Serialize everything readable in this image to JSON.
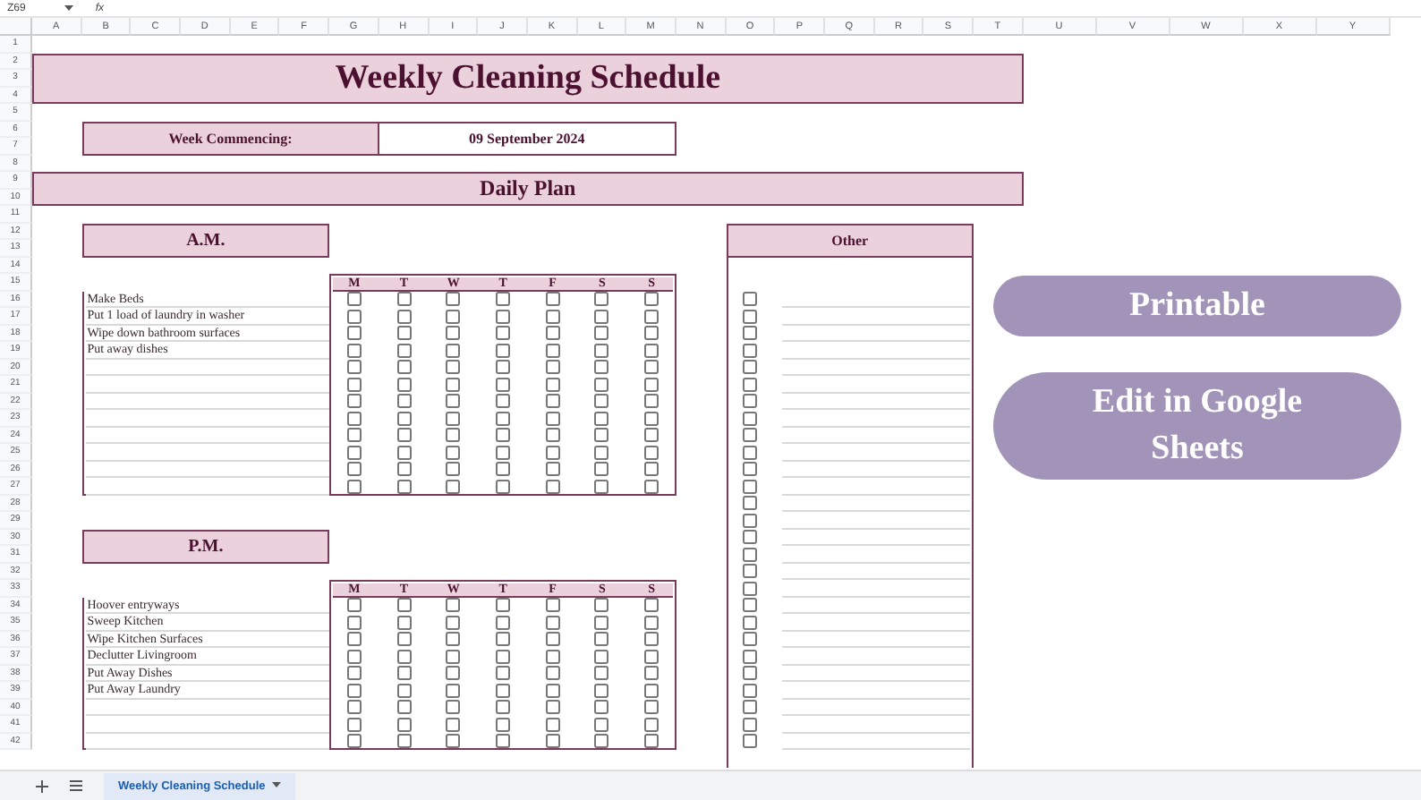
{
  "toolbar": {
    "cell_ref": "Z69",
    "formula_label": "fx"
  },
  "column_headers": [
    "A",
    "B",
    "C",
    "D",
    "E",
    "F",
    "G",
    "H",
    "I",
    "J",
    "K",
    "L",
    "M",
    "N",
    "O",
    "P",
    "Q",
    "R",
    "S",
    "T",
    "U",
    "V",
    "W",
    "X",
    "Y"
  ],
  "row_numbers": [
    "1",
    "2",
    "3",
    "4",
    "5",
    "6",
    "7",
    "8",
    "9",
    "10",
    "11",
    "12",
    "13",
    "14",
    "15",
    "16",
    "17",
    "18",
    "19",
    "20",
    "21",
    "22",
    "23",
    "24",
    "25",
    "26",
    "27",
    "28",
    "29",
    "30",
    "31",
    "32",
    "33",
    "34",
    "35",
    "36",
    "37",
    "38",
    "39",
    "40",
    "41",
    "42"
  ],
  "title": "Weekly Cleaning Schedule",
  "week": {
    "label": "Week Commencing:",
    "value": "09 September 2024"
  },
  "section_title": "Daily Plan",
  "am": {
    "title": "A.M.",
    "days": [
      "M",
      "T",
      "W",
      "T",
      "F",
      "S",
      "S"
    ],
    "tasks": [
      {
        "text": "Make Beds",
        "checks": [
          false,
          false,
          false,
          false,
          false,
          false,
          false
        ]
      },
      {
        "text": "Put 1 load of laundry in washer",
        "checks": [
          false,
          false,
          false,
          false,
          false,
          false,
          false
        ]
      },
      {
        "text": "Wipe down bathroom surfaces",
        "checks": [
          false,
          false,
          false,
          false,
          false,
          false,
          false
        ]
      },
      {
        "text": "Put away dishes",
        "checks": [
          false,
          false,
          false,
          false,
          false,
          false,
          false
        ]
      },
      {
        "checks": [
          false,
          false,
          false,
          false,
          false,
          false,
          false
        ]
      },
      {
        "checks": [
          false,
          false,
          false,
          false,
          false,
          false,
          false
        ]
      },
      {
        "checks": [
          false,
          false,
          false,
          false,
          false,
          false,
          false
        ]
      },
      {
        "checks": [
          false,
          false,
          false,
          false,
          false,
          false,
          false
        ]
      },
      {
        "checks": [
          false,
          false,
          false,
          false,
          false,
          false,
          false
        ]
      },
      {
        "checks": [
          false,
          false,
          false,
          false,
          false,
          false,
          false
        ]
      },
      {
        "checks": [
          false,
          false,
          false,
          false,
          false,
          false,
          false
        ]
      },
      {
        "checks": [
          false,
          false,
          false,
          false,
          false,
          false,
          false
        ]
      }
    ]
  },
  "pm": {
    "title": "P.M.",
    "days": [
      "M",
      "T",
      "W",
      "T",
      "F",
      "S",
      "S"
    ],
    "tasks": [
      {
        "text": "Hoover entryways",
        "checks": [
          false,
          false,
          false,
          false,
          false,
          false,
          false
        ]
      },
      {
        "text": "Sweep Kitchen",
        "checks": [
          false,
          false,
          false,
          false,
          false,
          false,
          false
        ]
      },
      {
        "text": "Wipe Kitchen Surfaces",
        "checks": [
          false,
          false,
          false,
          false,
          false,
          false,
          false
        ]
      },
      {
        "text": "Declutter Livingroom",
        "checks": [
          false,
          false,
          false,
          false,
          false,
          false,
          false
        ]
      },
      {
        "text": "Put Away Dishes",
        "checks": [
          false,
          false,
          false,
          false,
          false,
          false,
          false
        ]
      },
      {
        "text": "Put Away Laundry",
        "checks": [
          false,
          false,
          false,
          false,
          false,
          false,
          false
        ]
      },
      {
        "checks": [
          false,
          false,
          false,
          false,
          false,
          false,
          false
        ]
      },
      {
        "checks": [
          false,
          false,
          false,
          false,
          false,
          false,
          false
        ]
      },
      {
        "checks": [
          false,
          false,
          false,
          false,
          false,
          false,
          false
        ]
      }
    ]
  },
  "other": {
    "title": "Other",
    "items": [
      {
        "checked": false
      },
      {
        "checked": false
      },
      {
        "checked": false
      },
      {
        "checked": false
      },
      {
        "checked": false
      },
      {
        "checked": false
      },
      {
        "checked": false
      },
      {
        "checked": false
      },
      {
        "checked": false
      },
      {
        "checked": false
      },
      {
        "checked": false
      },
      {
        "checked": false
      },
      {
        "checked": false
      },
      {
        "checked": false
      },
      {
        "checked": false
      },
      {
        "checked": false
      },
      {
        "checked": false
      },
      {
        "checked": false
      },
      {
        "checked": false
      },
      {
        "checked": false
      },
      {
        "checked": false
      },
      {
        "checked": false
      },
      {
        "checked": false
      },
      {
        "checked": false
      },
      {
        "checked": false
      },
      {
        "checked": false
      },
      {
        "checked": false
      }
    ]
  },
  "buttons": [
    {
      "label": "Printable"
    },
    {
      "label": "Edit in Google Sheets"
    }
  ],
  "sheet_tabs": [
    {
      "label": "Weekly Cleaning Schedule",
      "selected": true
    }
  ]
}
